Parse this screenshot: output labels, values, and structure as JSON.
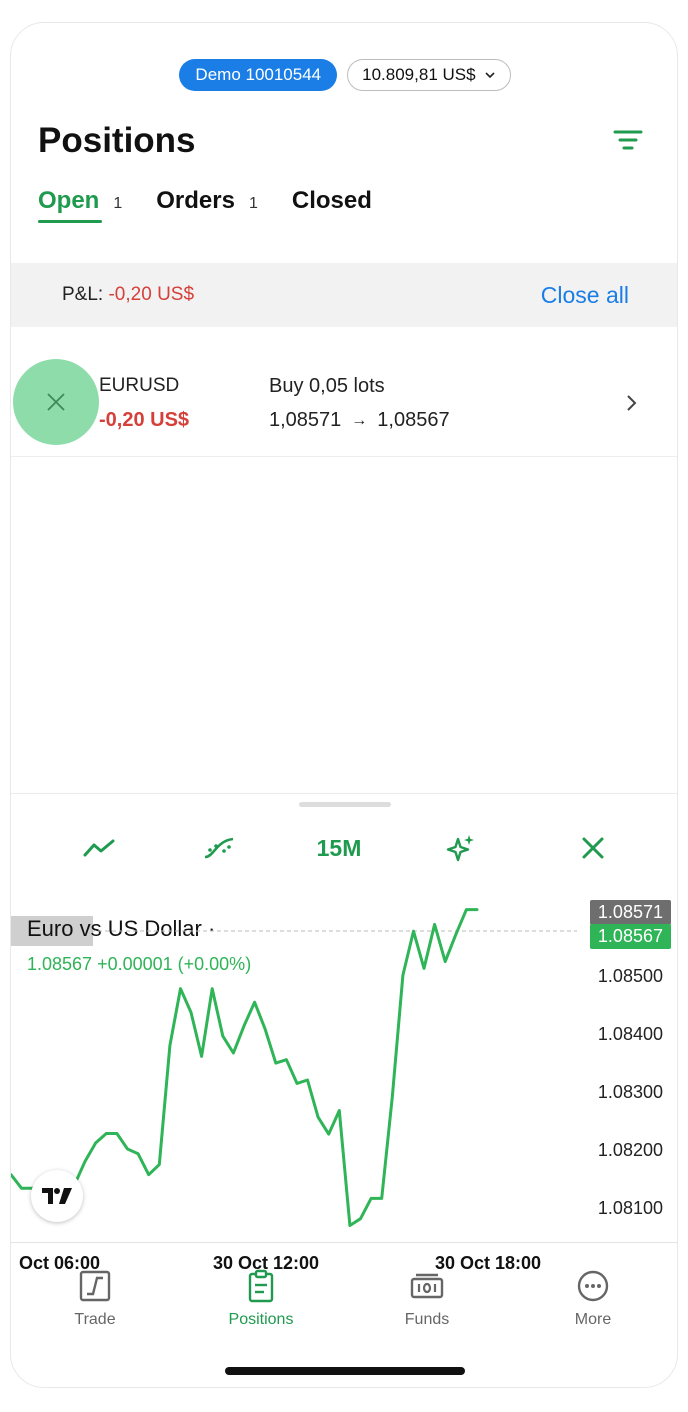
{
  "account": {
    "demo_label": "Demo 10010544",
    "balance": "10.809,81 US$"
  },
  "page": {
    "title": "Positions"
  },
  "tabs": [
    {
      "label": "Open",
      "count": "1",
      "active": true
    },
    {
      "label": "Orders",
      "count": "1",
      "active": false
    },
    {
      "label": "Closed",
      "count": "",
      "active": false
    }
  ],
  "pnl": {
    "label": "P&L:",
    "value": "-0,20 US$",
    "close_all": "Close all"
  },
  "position": {
    "symbol": "EURUSD",
    "pnl": "-0,20 US$",
    "side": "Buy 0,05 lots",
    "open_price": "1,08571",
    "current_price": "1,08567",
    "arrow": "→"
  },
  "chart_toolbar": {
    "timeframe": "15M",
    "icons": [
      "line-chart-icon",
      "indicator-icon",
      "sparkle-icon",
      "close-icon"
    ]
  },
  "chart_data": {
    "type": "line",
    "title": "Euro vs US Dollar ·",
    "quote_line": "1.08567  +0.00001 (+0.00%)",
    "ask_tag": "1.08571",
    "bid_tag": "1.08567",
    "y_ticks": [
      "1.08500",
      "1.08400",
      "1.08300",
      "1.08200",
      "1.08100"
    ],
    "ylim": [
      1.0808,
      1.0859
    ],
    "x_ticks": [
      "Oct 06:00",
      "30 Oct 12:00",
      "30 Oct 18:00"
    ],
    "series": [
      {
        "color": "#2fb457",
        "values": [
          1.08175,
          1.08155,
          1.08155,
          1.08163,
          1.08155,
          1.0815,
          1.0816,
          1.08195,
          1.08222,
          1.08236,
          1.08236,
          1.08213,
          1.08206,
          1.08175,
          1.0819,
          1.08366,
          1.0845,
          1.08415,
          1.0835,
          1.0845,
          1.0838,
          1.08355,
          1.08395,
          1.0843,
          1.0839,
          1.0834,
          1.08345,
          1.0831,
          1.08315,
          1.0826,
          1.08235,
          1.0827,
          1.081,
          1.0811,
          1.0814,
          1.0814,
          1.0829,
          1.0847,
          1.08535,
          1.0848,
          1.08545,
          1.0849,
          1.0853,
          1.08567,
          1.08567
        ]
      }
    ]
  },
  "nav": [
    {
      "label": "Trade",
      "icon": "trade-icon",
      "active": false
    },
    {
      "label": "Positions",
      "icon": "positions-icon",
      "active": true
    },
    {
      "label": "Funds",
      "icon": "funds-icon",
      "active": false
    },
    {
      "label": "More",
      "icon": "more-icon",
      "active": false
    }
  ],
  "colors": {
    "accent_green": "#1f9a4e",
    "link_blue": "#1a7ee6",
    "loss_red": "#d6403b",
    "chart_green": "#2fb457"
  }
}
